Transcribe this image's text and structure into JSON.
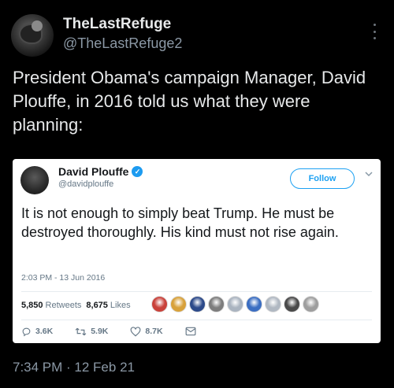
{
  "tweet": {
    "display_name": "TheLastRefuge",
    "handle": "@TheLastRefuge2",
    "text": "President Obama's campaign Manager, David Plouffe, in 2016 told us what they were planning:",
    "timestamp": "7:34 PM · 12 Feb 21"
  },
  "embedded": {
    "name": "David Plouffe",
    "handle": "@davidplouffe",
    "follow_label": "Follow",
    "text": "It is not enough to simply beat Trump. He must be destroyed thoroughly. His kind must not rise again.",
    "time": "2:03 PM - 13 Jun 2016",
    "retweets_count": "5,850",
    "retweets_label": "Retweets",
    "likes_count": "8,675",
    "likes_label": "Likes",
    "replies": "3.6K",
    "retweets_short": "5.9K",
    "likes_short": "8.7K",
    "liker_colors": [
      "#c9413a",
      "#d8a13a",
      "#2c4a8a",
      "#7d7d7d",
      "#aab4c0",
      "#3b6ec2",
      "#b0b8c2",
      "#4a4a4a",
      "#9e9e9e"
    ]
  }
}
